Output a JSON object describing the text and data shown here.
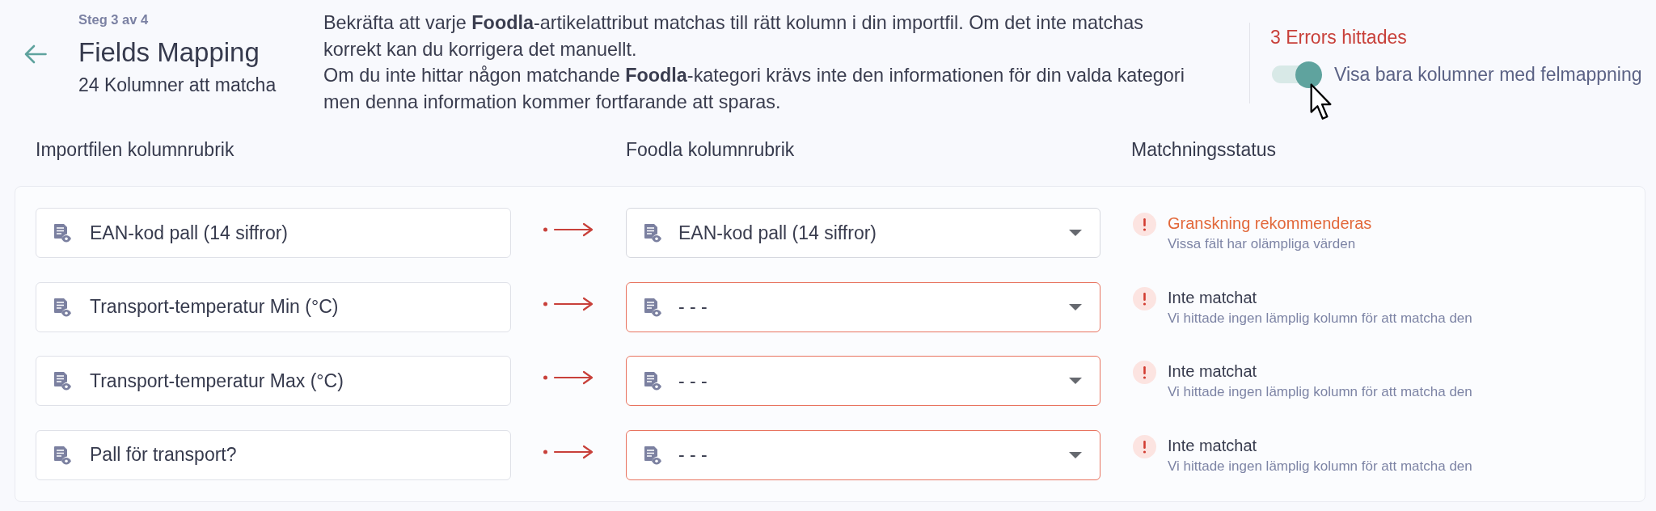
{
  "header": {
    "step": "Steg 3 av 4",
    "title": "Fields Mapping",
    "subtitle": "24 Kolumner att matcha"
  },
  "description": [
    "Bekräfta att varje **Foodla**-artikelattribut matchas till rätt kolumn i din importfil. Om det inte matchas korrekt kan du korrigera det manuellt.",
    "Om du inte hittar någon matchande **Foodla**-kategori krävs inte den informationen för din valda kategori men denna information kommer fortfarande att sparas."
  ],
  "summary": {
    "errors": "3 Errors hittades",
    "toggle": {
      "label": "Visa bara kolumner med felmappning",
      "on": true
    }
  },
  "columns": [
    "Importfilen kolumnrubrik",
    "Foodla kolumnrubrik",
    "Matchningsstatus"
  ],
  "rows": [
    {
      "import_column": "EAN-kod pall (14 siffror)",
      "foodla_column": "EAN-kod pall (14 siffror)",
      "invalid": false,
      "status": {
        "kind": "warning",
        "title": "Granskning rekommenderas",
        "detail": "Vissa fält har olämpliga värden"
      }
    },
    {
      "import_column": "Transport-temperatur Min (°C)",
      "foodla_column": "- - -",
      "invalid": true,
      "status": {
        "kind": "error",
        "title": "Inte matchat",
        "detail": "Vi hittade ingen lämplig kolumn för att matcha den"
      }
    },
    {
      "import_column": "Transport-temperatur Max (°C)",
      "foodla_column": "- - -",
      "invalid": true,
      "status": {
        "kind": "error",
        "title": "Inte matchat",
        "detail": "Vi hittade ingen lämplig kolumn för att matcha den"
      }
    },
    {
      "import_column": "Pall för transport?",
      "foodla_column": "- - -",
      "invalid": true,
      "status": {
        "kind": "error",
        "title": "Inte matchat",
        "detail": "Vi hittade ingen lämplig kolumn för att matcha den"
      }
    }
  ]
}
